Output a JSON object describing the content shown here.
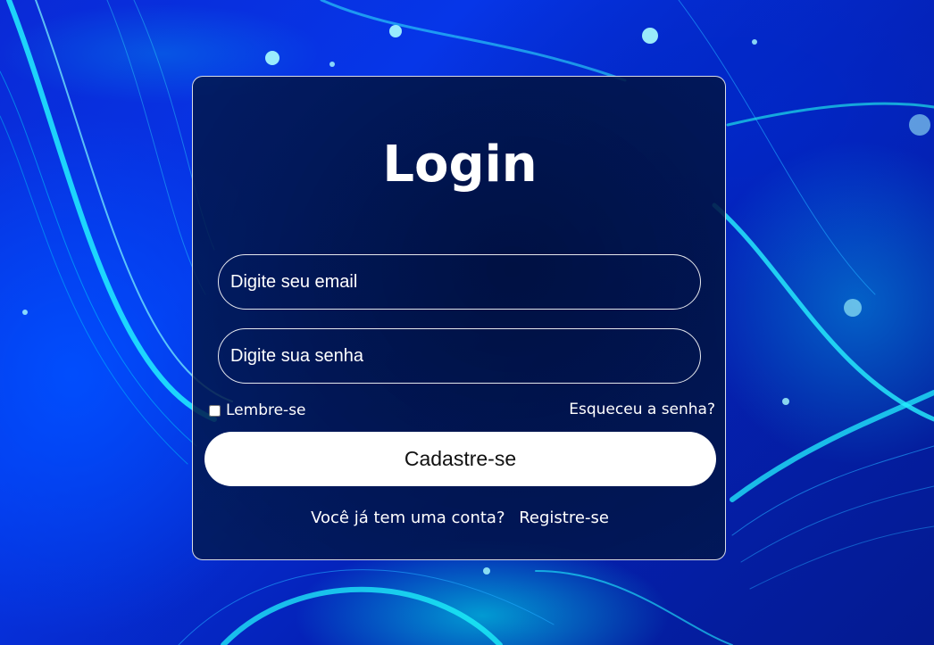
{
  "login": {
    "title": "Login",
    "email_placeholder": "Digite seu email",
    "password_placeholder": "Digite sua senha",
    "remember_label": "Lembre-se",
    "forgot_label": "Esqueceu a senha?",
    "submit_label": "Cadastre-se",
    "footer_text": "Você já tem uma conta?",
    "register_label": "Registre-se"
  },
  "colors": {
    "background": "#0636e8",
    "accent": "#00f0ff",
    "card": "#031a4f",
    "button": "#ffffff"
  }
}
